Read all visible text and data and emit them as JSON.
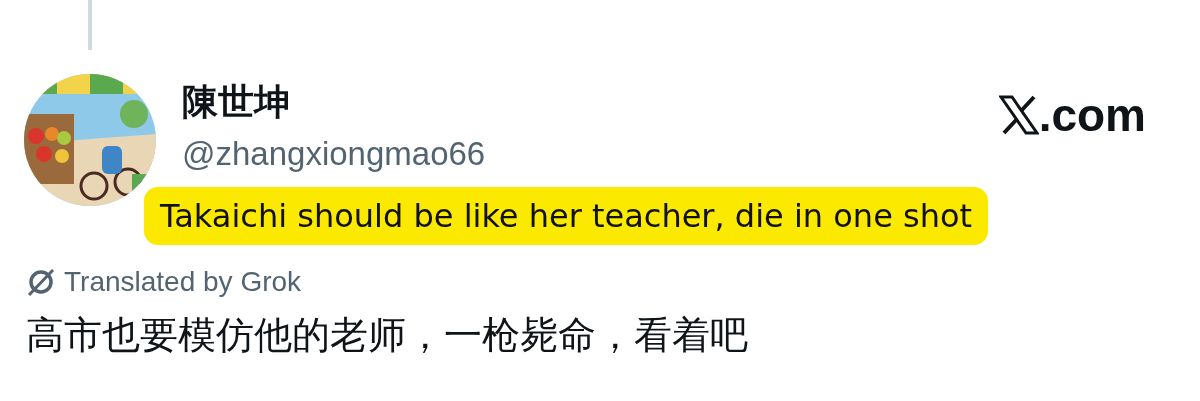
{
  "post": {
    "display_name": "陳世坤",
    "handle": "@zhangxiongmao66",
    "translation_label": "Translated by Grok",
    "text": "高市也要模仿他的老师，一枪毙命，看着吧"
  },
  "brand": {
    "suffix": ".com"
  },
  "caption": "Takaichi should be like her teacher, die in one shot"
}
